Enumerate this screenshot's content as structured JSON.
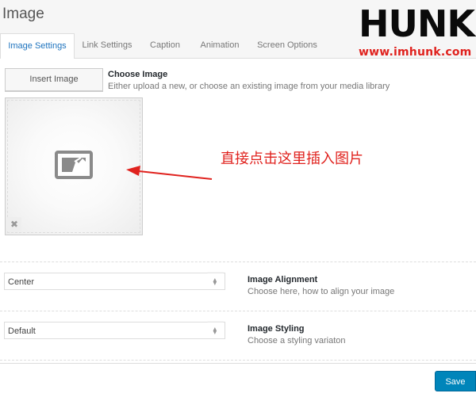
{
  "header": {
    "title": "Image"
  },
  "logo": {
    "word": "HUNK",
    "url": "www.imhunk.com"
  },
  "tabs": [
    {
      "label": "Image Settings"
    },
    {
      "label": "Link Settings"
    },
    {
      "label": "Caption"
    },
    {
      "label": "Animation"
    },
    {
      "label": "Screen Options"
    }
  ],
  "choose_image": {
    "button_label": "Insert Image",
    "title": "Choose Image",
    "description": "Either upload a new, or choose an existing image from your media library"
  },
  "annotation": {
    "text": "直接点击这里插入图片"
  },
  "alignment": {
    "selected": "Center",
    "title": "Image Alignment",
    "description": "Choose here, how to align your image"
  },
  "styling": {
    "selected": "Default",
    "title": "Image Styling",
    "description": "Choose a styling variaton"
  },
  "footer": {
    "save_label": "Save"
  },
  "icons": {
    "placeholder": "image-placeholder-icon",
    "remove": "close-icon",
    "select_arrows": "updown-arrows-icon"
  },
  "colors": {
    "accent": "#0085ba",
    "tab_active": "#1e73be",
    "annotation": "#e0221e"
  }
}
